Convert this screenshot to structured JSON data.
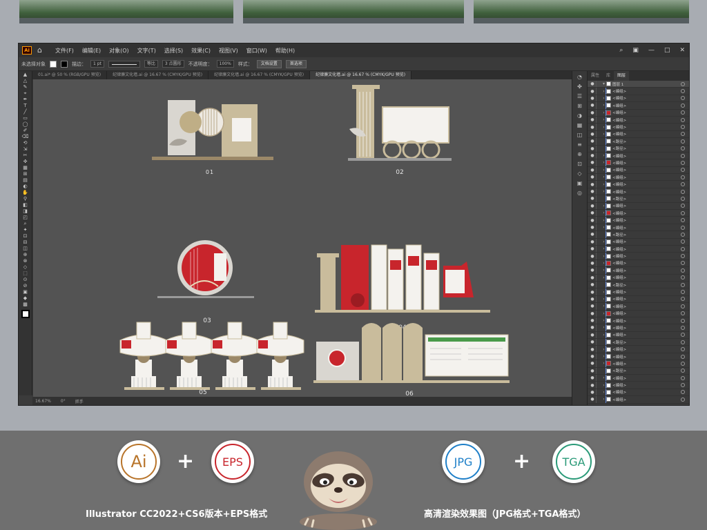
{
  "app": {
    "menus": [
      "文件(F)",
      "编辑(E)",
      "对象(O)",
      "文字(T)",
      "选择(S)",
      "效果(C)",
      "视图(V)",
      "窗口(W)",
      "帮助(H)"
    ],
    "control": {
      "selection_label": "未选择对象",
      "stroke_label": "描边：",
      "stroke_value": "1 pt",
      "stroke_style": "等比",
      "brush_label": "3 点圆形",
      "opacity_label": "不透明度：",
      "opacity_value": "100%",
      "style_label": "样式：",
      "doc_setup_button": "文档设置",
      "prefs_button": "首选项"
    },
    "tabs": [
      {
        "label": "01.ai* @ 50 % (RGB/GPU 预览)",
        "active": false
      },
      {
        "label": "纪律廉文化墙.ai @ 16.67 % (CMYK/GPU 预览)",
        "active": false
      },
      {
        "label": "纪律廉文化墙.ai @ 16.67 % (CMYK/GPU 预览)",
        "active": false
      },
      {
        "label": "纪律廉文化墙.ai @ 16.67 % (CMYK/GPU 预览)",
        "active": true
      }
    ],
    "statusbar": {
      "zoom": "16.67%",
      "angle": "0°",
      "tool": "抓手"
    },
    "artboards": [
      "01",
      "02",
      "03",
      "04",
      "05",
      "06"
    ],
    "panel_tabs": [
      {
        "label": "属性",
        "active": false
      },
      {
        "label": "库",
        "active": false
      },
      {
        "label": "图层",
        "active": true
      }
    ],
    "layers": {
      "top_layer": "图层 1",
      "items": [
        "<编组>",
        "<编组>",
        "<编组>",
        "<编组>",
        "<编组>",
        "<编组>",
        "<编组>",
        "<路径>",
        "<路径>",
        "<编组>",
        "<编组>",
        "<编组>",
        "<编组>",
        "<编组>",
        "<编组>",
        "<路径>",
        "<编组>",
        "<编组>",
        "<编组>",
        "<编组>",
        "<路径>",
        "<编组>",
        "<编组>",
        "<编组>",
        "<编组>",
        "<编组>",
        "<编组>",
        "<路径>",
        "<编组>",
        "<编组>",
        "<编组>",
        "<编组>",
        "<编组>",
        "<编组>",
        "<编组>",
        "<路径>",
        "<编组>",
        "<编组>",
        "<编组>",
        "<路径>",
        "<编组>",
        "<编组>",
        "<编组>",
        "<编组>",
        "<编组>",
        "<编组>",
        "<路径>",
        "<编组>",
        "<编组>",
        "<编组>",
        "<编组>",
        "<编组>",
        "<编组>",
        "<编组>",
        "<编组>",
        "<编组>",
        "<编组>",
        "<编组>",
        "<编组>",
        "<编组>",
        "<编组>",
        "<编组>",
        "<编组>",
        "<编组>",
        "<编组>",
        "<编组>",
        "<路径>",
        "<编组>",
        "<编组>",
        "<编组>",
        "<编组>",
        "<编组>",
        "<编组>",
        "<编组>",
        "<编组>",
        "<编组>",
        "<编组>",
        "<编组>",
        "<编组>",
        "<编组>",
        "<编组>",
        "<编组>",
        "<编组>",
        "<编组>",
        "<编组>",
        "<编组>",
        "<编组>",
        "<编组>",
        "<编组>",
        "<编组>",
        "<编组>",
        "<编组>",
        "<编组>",
        "<编组>",
        "<编组>",
        "<编组>",
        "<编组>",
        "<编组>",
        "<编组>",
        "<编组>",
        "<编组>",
        "<编组>",
        "<编组>",
        "<编组>",
        "<编组>",
        "<编组>",
        "<编组>",
        "<编组>",
        "<编组>",
        "<编组>",
        "<编组>",
        "<编组>",
        "<编组>",
        "<编组>",
        "<编组>",
        "<编组>",
        "<编组>",
        "<编组>",
        "<编组>",
        "<编组>",
        "<编组>",
        "<编组>",
        "<编组>",
        "<编组>",
        "<编组>",
        "<编组>",
        "<编组>",
        "<编组>",
        "<编组>",
        "<编组>",
        "<编组>",
        "<编组>",
        "<编组>",
        "<编组>",
        "<编组>",
        "<编组>",
        "<编组>",
        "<编组>",
        "<编组>",
        "<编组>"
      ]
    }
  },
  "promo": {
    "badges": [
      {
        "text": "Ai",
        "color": "#b8742a"
      },
      {
        "text": "EPS",
        "color": "#c8252c"
      },
      {
        "text": "JPG",
        "color": "#1e7fc8"
      },
      {
        "text": "TGA",
        "color": "#2a9a78"
      }
    ],
    "plus": "+",
    "caption_left": "Illustrator CC2022+CS6版本+EPS格式",
    "caption_right": "高清渲染效果图（JPG格式+TGA格式）"
  },
  "colors": {
    "accent_red": "#c8252c",
    "beige": "#b8a88a",
    "canvas": "#535353"
  }
}
